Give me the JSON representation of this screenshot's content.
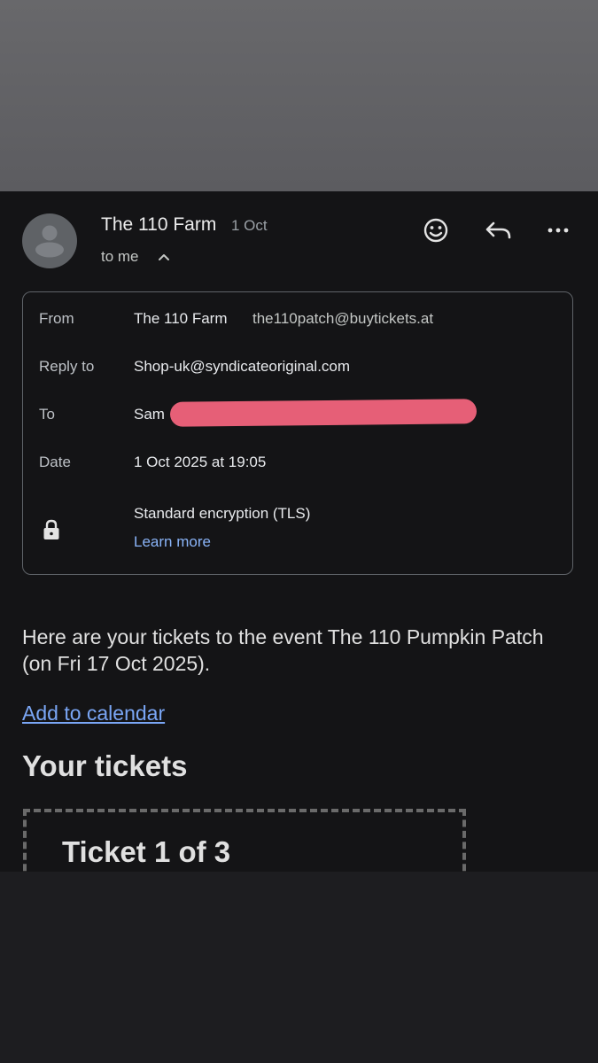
{
  "header": {
    "sender_name": "The 110 Farm",
    "date": "1 Oct",
    "recipient_summary": "to me"
  },
  "icons": {
    "emoji": "smiley-icon",
    "reply": "reply-icon",
    "more": "more-vertical-dots-icon",
    "lock": "lock-icon",
    "expand": "chevron-up-icon",
    "avatar": "person-avatar-icon"
  },
  "details": {
    "from_label": "From",
    "from_name": "The 110 Farm",
    "from_email": "the110patch@buytickets.at",
    "reply_to_label": "Reply to",
    "reply_to_value": "Shop-uk@syndicateoriginal.com",
    "to_label": "To",
    "to_value": "Sam",
    "date_label": "Date",
    "date_value": "1 Oct 2025 at 19:05",
    "encryption_text": "Standard encryption (TLS)",
    "learn_more": "Learn more"
  },
  "body": {
    "intro": "Here are your tickets to the event The 110 Pumpkin Patch (on Fri 17 Oct 2025).",
    "add_to_calendar": "Add to calendar",
    "tickets_heading": "Your tickets",
    "ticket_title": "Ticket 1 of 3"
  },
  "colors": {
    "background": "#141416",
    "link": "#8ab4f8",
    "redaction": "#e65f77"
  }
}
